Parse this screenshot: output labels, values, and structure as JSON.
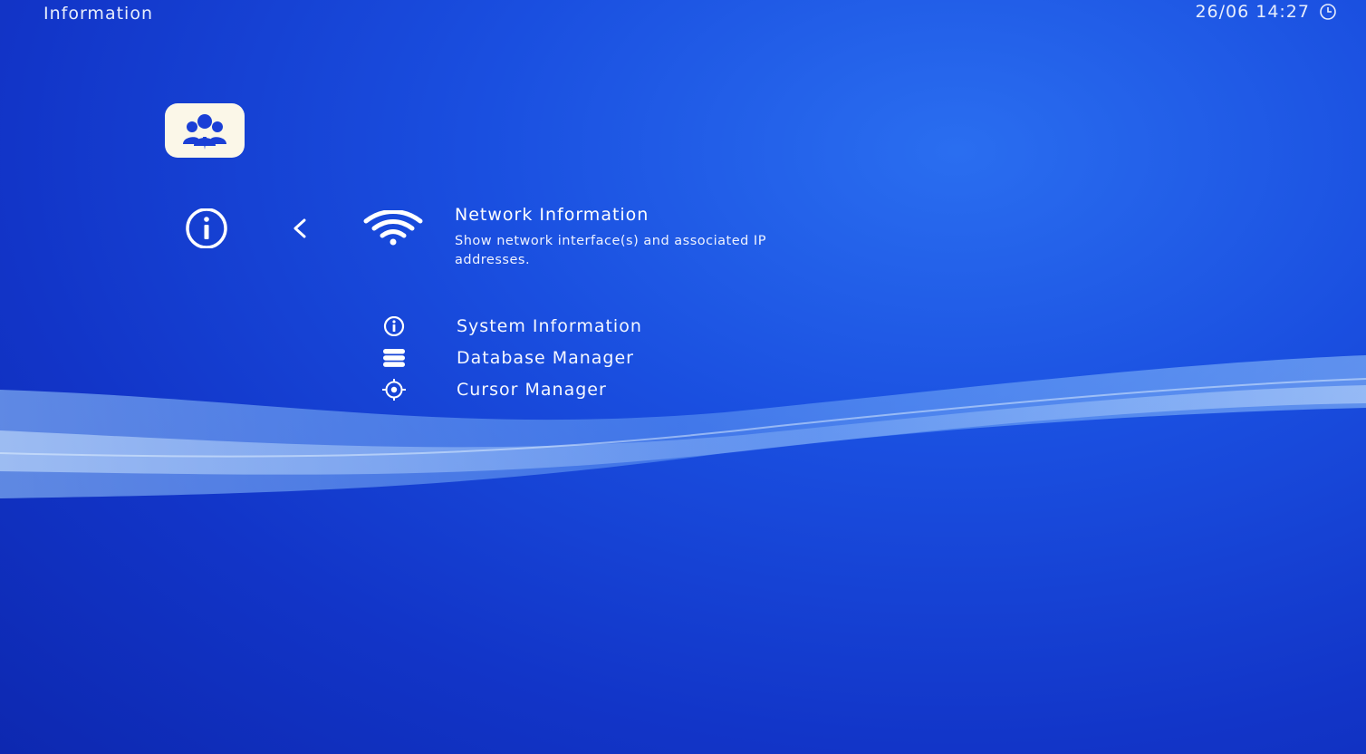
{
  "header": {
    "title": "Information",
    "datetime": "26/06 14:27",
    "clock_icon": "clock-icon"
  },
  "app_badge": {
    "icon": "users-group-icon"
  },
  "category": {
    "icon": "info-circle-icon"
  },
  "navigation": {
    "back_icon": "chevron-left-icon"
  },
  "selected": {
    "icon": "wifi-icon",
    "title": "Network Information",
    "description": "Show network interface(s) and associated IP addresses."
  },
  "menu": {
    "items": [
      {
        "label": "System Information",
        "icon": "info-circle-icon"
      },
      {
        "label": "Database Manager",
        "icon": "database-icon"
      },
      {
        "label": "Cursor Manager",
        "icon": "target-icon"
      }
    ]
  },
  "colors": {
    "background_primary": "#1a4fe0",
    "background_dark": "#0d28b0",
    "text": "#ffffff",
    "badge_background": "#fbf7e8",
    "badge_icon": "#1a3fd6"
  }
}
